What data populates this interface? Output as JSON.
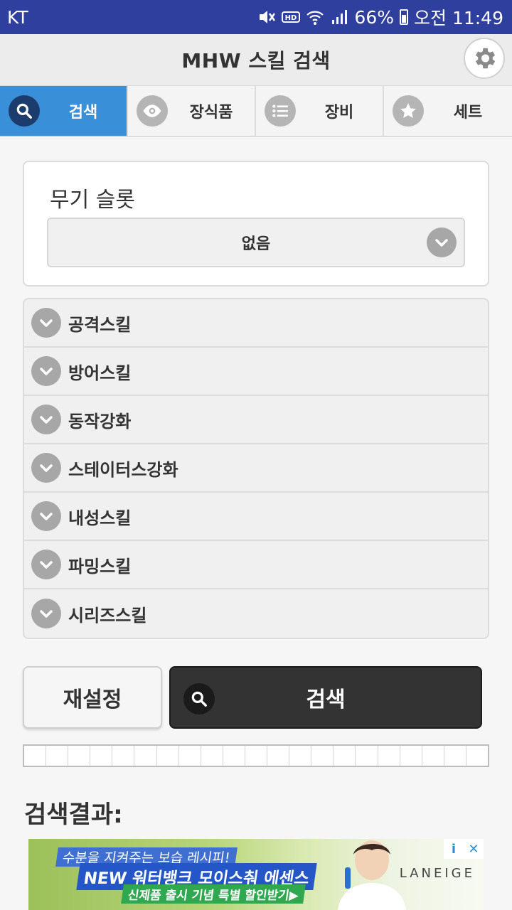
{
  "status_bar": {
    "carrier": "KT",
    "battery": "66%",
    "time": "오전 11:49"
  },
  "header": {
    "title": "MHW 스킬 검색"
  },
  "tabs": [
    {
      "label": "검색",
      "icon": "search-icon",
      "active": true
    },
    {
      "label": "장식품",
      "icon": "eye-icon",
      "active": false
    },
    {
      "label": "장비",
      "icon": "list-icon",
      "active": false
    },
    {
      "label": "세트",
      "icon": "star-icon",
      "active": false
    }
  ],
  "weapon_slot": {
    "title": "무기 슬롯",
    "selected": "없음"
  },
  "skill_categories": [
    {
      "label": "공격스킬"
    },
    {
      "label": "방어스킬"
    },
    {
      "label": "동작강화"
    },
    {
      "label": "스테이터스강화"
    },
    {
      "label": "내성스킬"
    },
    {
      "label": "파밍스킬"
    },
    {
      "label": "시리즈스킬"
    }
  ],
  "actions": {
    "reset_label": "재설정",
    "search_label": "검색"
  },
  "results": {
    "title": "검색결과:"
  },
  "ad": {
    "line1": "수분을 지켜주는 보습 레시피!",
    "line2": "NEW 워터뱅크 모이스춰 에센스",
    "line3": "신제품 출시 기념 특별 할인받기▶",
    "brand": "LANEIGE",
    "info_icon": "i",
    "close_icon": "✕"
  },
  "colors": {
    "status_bar": "#2f3f9e",
    "active_tab": "#3a8fd9",
    "search_button": "#333333"
  }
}
